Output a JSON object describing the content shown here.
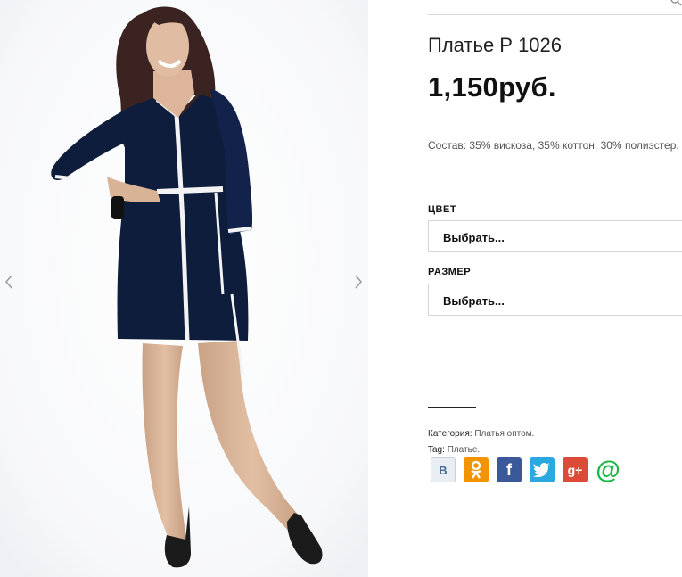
{
  "product": {
    "title": "Платье Р 1026",
    "price": "1,150руб.",
    "description": "Состав: 35% вискоза, 35% коттон, 30% полиэстер."
  },
  "options": {
    "color": {
      "label": "ЦВЕТ",
      "selected": "Выбрать..."
    },
    "size": {
      "label": "РАЗМЕР",
      "selected": "Выбрать..."
    }
  },
  "meta": {
    "category_label": "Категория:",
    "category_value": "Платья оптом.",
    "tag_label": "Tag:",
    "tag_value": "Платье."
  },
  "share": [
    {
      "name": "vkontakte",
      "glyph": "B",
      "color": "#e9eef4"
    },
    {
      "name": "odnoklassniki",
      "glyph": "OK",
      "color": "#f29400"
    },
    {
      "name": "facebook",
      "glyph": "f",
      "color": "#3b5998"
    },
    {
      "name": "twitter",
      "glyph": "t",
      "color": "#2aa9e0"
    },
    {
      "name": "google-plus",
      "glyph": "g+",
      "color": "#dc4a38"
    },
    {
      "name": "mail-ru",
      "glyph": "@",
      "color": "#16b843"
    }
  ],
  "icons": {
    "prev": "chevron-left-icon",
    "next": "chevron-right-icon",
    "search": "search-icon"
  }
}
